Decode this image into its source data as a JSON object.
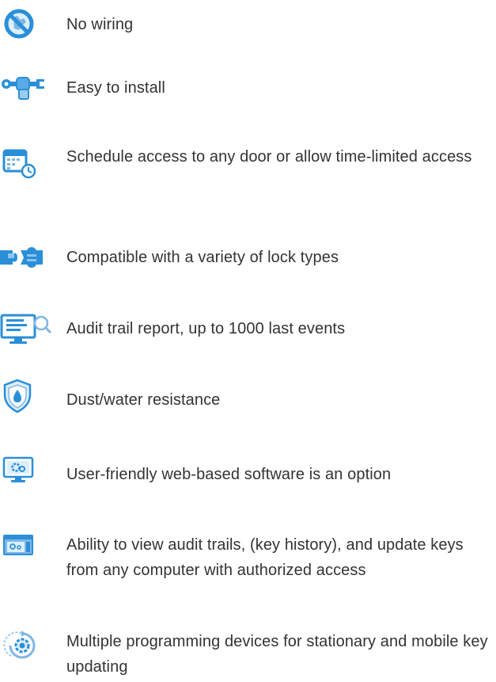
{
  "accent_color": "#2a8fd8",
  "features": [
    {
      "icon": "no-wiring-icon",
      "text": "No wiring"
    },
    {
      "icon": "wrench-fist-icon",
      "text": "Easy to install"
    },
    {
      "icon": "calendar-clock-icon",
      "text": "Schedule access to any door or allow time-limited access"
    },
    {
      "icon": "puzzle-icon",
      "text": "Compatible with a variety of lock types"
    },
    {
      "icon": "monitor-search-icon",
      "text": "Audit trail report, up to 1000 last events"
    },
    {
      "icon": "shield-drop-icon",
      "text": "Dust/water resistance"
    },
    {
      "icon": "monitor-gear-icon",
      "text": "User-friendly web-based software is an option"
    },
    {
      "icon": "browser-window-icon",
      "text": "Ability to view audit trails, (key history), and update keys from any computer with authorized access"
    },
    {
      "icon": "sync-gear-icon",
      "text": "Multiple programming devices for stationary and mobile key updating"
    }
  ]
}
